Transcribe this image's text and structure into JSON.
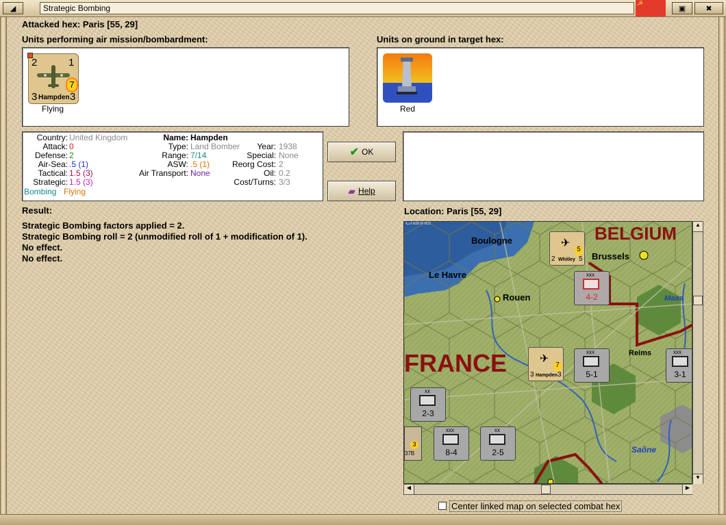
{
  "window": {
    "title": "Strategic Bombing",
    "attacked_hex": "Attacked hex: Paris  [55, 29]"
  },
  "air_units": {
    "heading": "Units performing air mission/bombardment:",
    "units": [
      {
        "name": "Hampden",
        "attack": "2",
        "defense": "1",
        "left_bottom": "3",
        "right_bottom": "3",
        "badge": "7",
        "caption": "Flying"
      }
    ]
  },
  "ground_units": {
    "heading": "Units on ground in target hex:",
    "units": [
      {
        "caption": "Red"
      }
    ]
  },
  "unit_info": {
    "country_label": "Country:",
    "country": "United Kingdom",
    "attack_label": "Attack:",
    "attack": "0",
    "defense_label": "Defense:",
    "defense": "2",
    "airsea_label": "Air-Sea:",
    "airsea": ".5 (1)",
    "tactical_label": "Tactical:",
    "tactical": "1.5 (3)",
    "strategic_label": "Strategic:",
    "strategic": "1.5 (3)",
    "mission": "Bombing",
    "status": "Flying",
    "name_label": "Name:",
    "name": "Hampden",
    "type_label": "Type:",
    "type": "Land Bomber",
    "range_label": "Range:",
    "range": "7/14",
    "asw_label": "ASW:",
    "asw": ".5 (1)",
    "air_transport_label": "Air Transport:",
    "air_transport": "None",
    "year_label": "Year:",
    "year": "1938",
    "special_label": "Special:",
    "special": "None",
    "reorg_label": "Reorg Cost:",
    "reorg": "2",
    "oil_label": "Oil:",
    "oil": "0.2",
    "cost_label": "Cost/Turns:",
    "cost": "3/3"
  },
  "buttons": {
    "ok": "OK",
    "help": "Help"
  },
  "result": {
    "heading": "Result:",
    "lines": [
      "Strategic Bombing factors applied = 2.",
      "Strategic Bombing roll = 2 (unmodified roll of 1 + modification of 1).",
      "No effect.",
      "No effect."
    ]
  },
  "location": {
    "heading": "Location:  Paris  [55, 29]"
  },
  "map": {
    "labels": {
      "channel": "Channel",
      "belgium": "BELGIUM",
      "france": "FRANCE",
      "boulogne": "Boulogne",
      "brussels": "Brussels",
      "le_havre": "Le Havre",
      "rouen": "Rouen",
      "reims": "Reims",
      "maas": "Maas",
      "saone": "Saône"
    },
    "counters": [
      {
        "id": "whitley",
        "name": "Whitley",
        "l": "2",
        "r": "5",
        "badge": "5"
      },
      {
        "id": "inf-4-2",
        "size": "xxx",
        "value": "4-2"
      },
      {
        "id": "hampden-map",
        "name": "Hampden",
        "l": "3",
        "r": "3",
        "badge": "7",
        "top": "3"
      },
      {
        "id": "inf-5-1",
        "size": "xxx",
        "value": "5-1"
      },
      {
        "id": "inf-3-1",
        "size": "xxx",
        "value": "3-1"
      },
      {
        "id": "inf-2-3",
        "size": "xx",
        "value": "2-3"
      },
      {
        "id": "inf-8-4",
        "size": "xxx",
        "value": "8-4"
      },
      {
        "id": "inf-2-5",
        "size": "xx",
        "value": "2-5",
        "top": "2"
      },
      {
        "id": "air-37b",
        "name": "37B",
        "badge": "3"
      }
    ]
  },
  "footer": {
    "center_map_label": "Center linked map on selected combat hex"
  }
}
